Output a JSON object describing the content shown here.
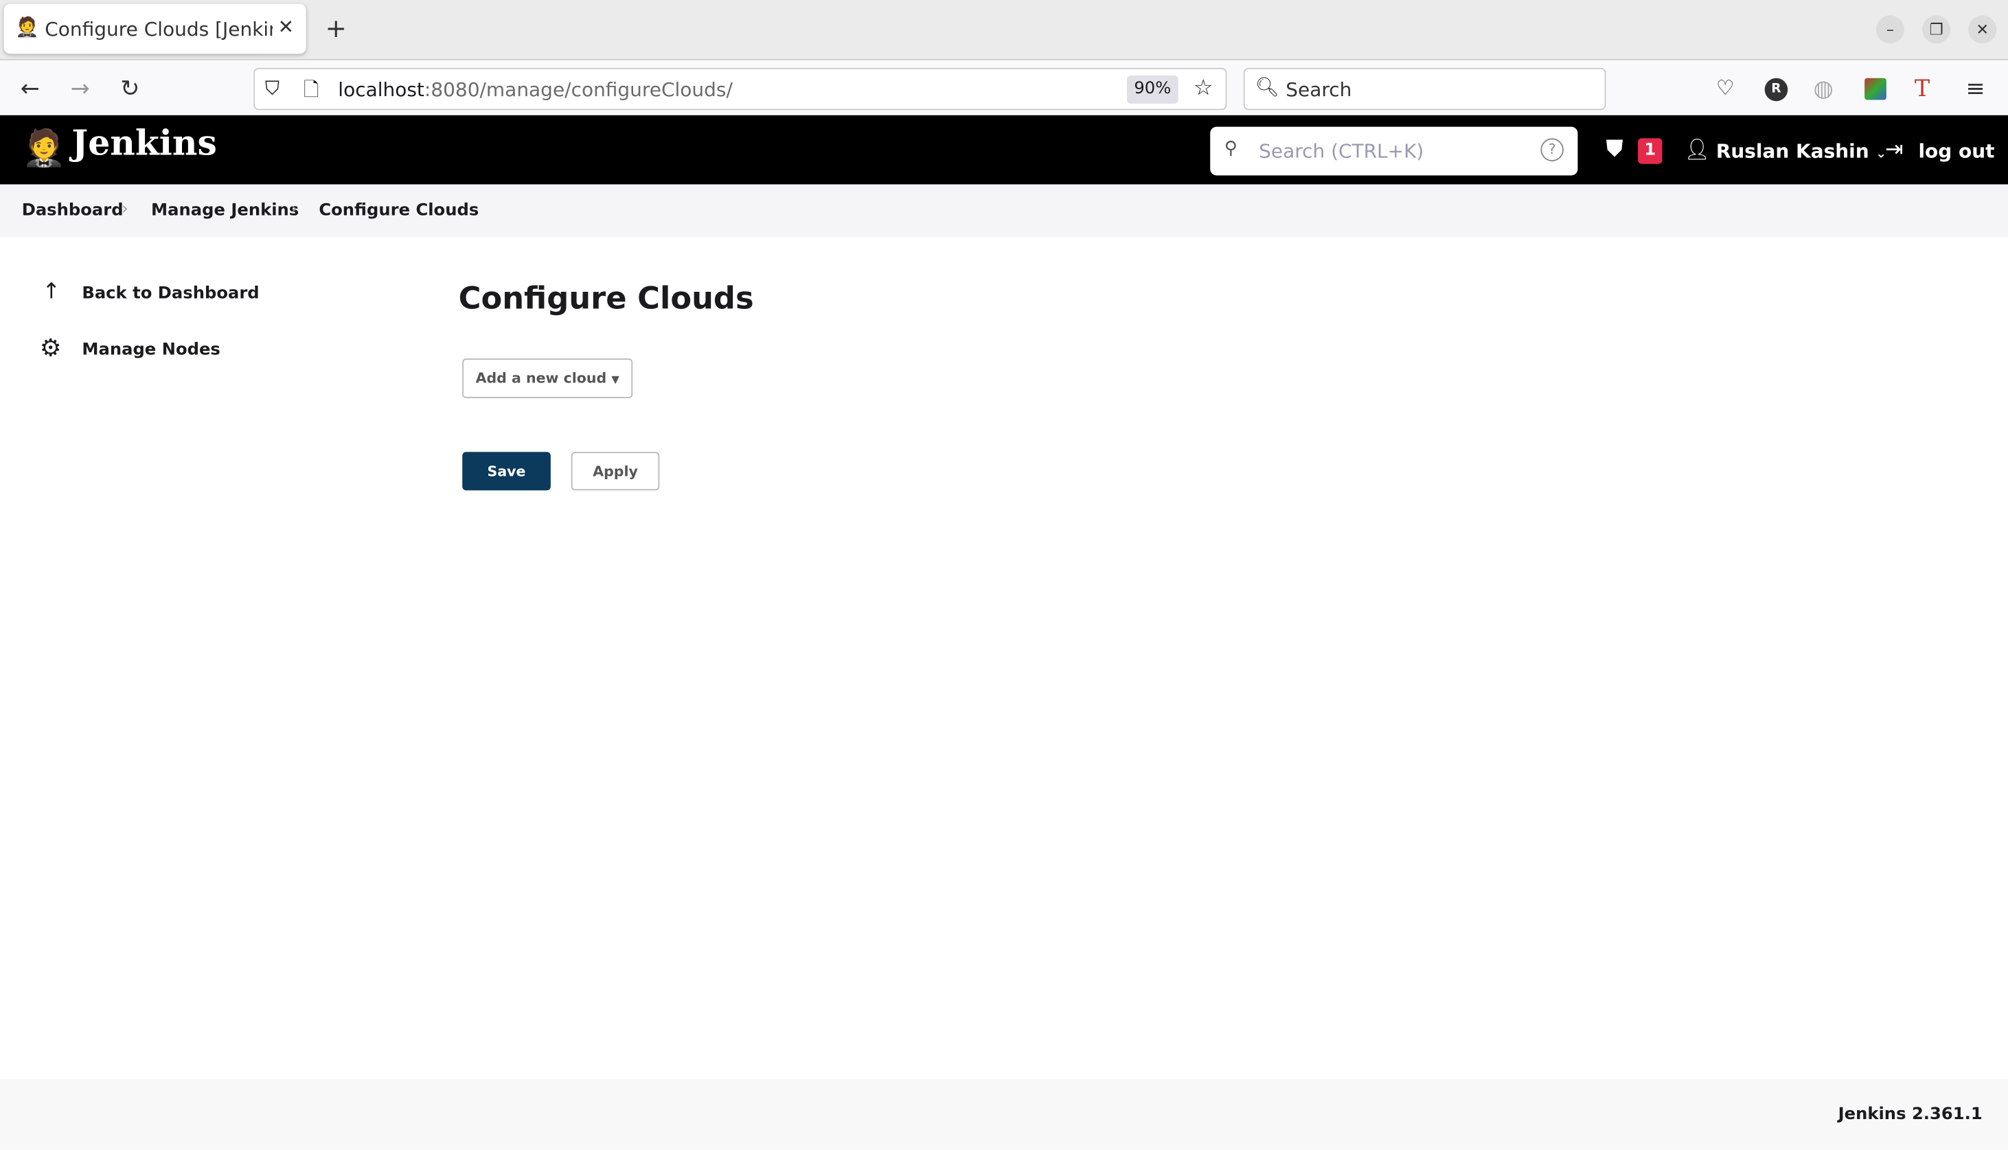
{
  "browser": {
    "tab_title": "Configure Clouds [Jenkins]",
    "new_tab": "+",
    "url_host": "localhost",
    "url_path": ":8080/manage/configureClouds/",
    "zoom": "90%",
    "search_label": "Search",
    "window_controls": {
      "minimize": "–",
      "restore": "❐",
      "close": "✕"
    }
  },
  "header": {
    "logo": "Jenkins",
    "search_placeholder": "Search (CTRL+K)",
    "security_count": "1",
    "user": "Ruslan Kashin",
    "logout": "log out"
  },
  "breadcrumb": [
    "Dashboard",
    "Manage Jenkins",
    "Configure Clouds"
  ],
  "sidebar": {
    "items": [
      {
        "label": "Back to Dashboard",
        "icon": "arrow-up-icon"
      },
      {
        "label": "Manage Nodes",
        "icon": "gear-icon"
      }
    ]
  },
  "main": {
    "title": "Configure Clouds",
    "add_cloud": "Add a new cloud",
    "save": "Save",
    "apply": "Apply"
  },
  "footer": {
    "version": "Jenkins 2.361.1"
  },
  "colors": {
    "save_button": "#0b3a5c",
    "header_bg": "#000000",
    "badge": "#e6294b"
  }
}
